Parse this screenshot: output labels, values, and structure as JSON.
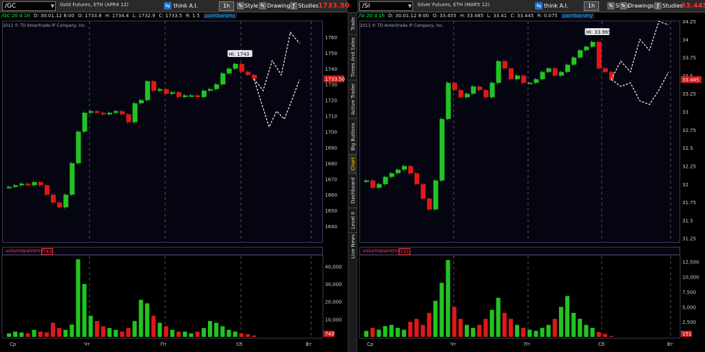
{
  "sidebar": {
    "tabs": [
      "Trade",
      "Times And Sales",
      "Active Trader",
      "Big Buttons",
      "Chart",
      "Dashboard",
      "Level II",
      "Live News"
    ],
    "active": "Chart"
  },
  "toolbar": {
    "think_label": "think A.I.",
    "timeframe": "1h",
    "style_label": "Style",
    "drawings_label": "Drawings",
    "studies_label": "Studies"
  },
  "panels": [
    {
      "symbol": "/GC",
      "description": "Gold Futures, ETH (APR4 12)",
      "last_price": "1733.50",
      "last_price_badge": "1733.50",
      "info": {
        "symbol_tag": "/GC 20 d 1h",
        "date": "D: 30.01.12 8:00",
        "open": "O: 1733.8",
        "high": "H: 1734.4",
        "low": "L: 1732.9",
        "close": "C: 1733.5",
        "range": "R: 1.5",
        "study": "paintbarsmy"
      },
      "copyright": "2011 © TD Ameritrade IP Company, Inc.",
      "hi_label": "Hi: 1743",
      "volume_label": "volumepaintmy",
      "volume_value": "743",
      "volume_badge": "743",
      "x_labels": [
        "Ср",
        "Чт",
        "Пт",
        "Сб",
        "Вт"
      ],
      "volume_axis": [
        "40,000",
        "30,000",
        "20,000",
        "10,000"
      ],
      "colors": {
        "up": "#22c422",
        "down": "#e01818"
      }
    },
    {
      "symbol": "/SI",
      "description": "Silver Futures, ETH (MAR5 12)",
      "last_price": "33.445",
      "last_price_badge": "33.445",
      "info": {
        "symbol_tag": "/SI 20 d 1h",
        "date": "D: 30.01.12 8:00",
        "open": "O: 33.455",
        "high": "H: 33.485",
        "low": "L: 33.41",
        "close": "C: 33.445",
        "range": "R: 0.075",
        "study": "paintbarsmy"
      },
      "copyright": "2011 © TD Ameritrade IP Company, Inc.",
      "hi_label": "Hi: 33.965",
      "volume_label": "volumepaintmy",
      "volume_value": "151",
      "volume_badge": "151",
      "x_labels": [
        "Ср",
        "Чт",
        "Пт",
        "Сб",
        "Вт"
      ],
      "volume_axis": [
        "12,500",
        "10,000",
        "7,500",
        "5,000",
        "2,500"
      ],
      "colors": {
        "up": "#22c422",
        "down": "#e01818"
      }
    }
  ],
  "chart_data": [
    {
      "type": "line",
      "title": "Gold Futures, ETH (APR4 12) — /GC 20 d 1h",
      "ylim": [
        1630,
        1770
      ],
      "yticks": [
        1640,
        1650,
        1660,
        1670,
        1680,
        1690,
        1700,
        1710,
        1720,
        1730,
        1740,
        1750,
        1760
      ],
      "x": [
        "Ср",
        "Чт",
        "Пт",
        "Сб",
        "Вт"
      ],
      "series": [
        {
          "name": "/GC",
          "values": [
            1665,
            1666,
            1667,
            1666,
            1668,
            1666,
            1660,
            1655,
            1652,
            1660,
            1680,
            1700,
            1712,
            1713,
            1712,
            1711,
            1712,
            1713,
            1711,
            1706,
            1718,
            1720,
            1732,
            1726,
            1727,
            1724,
            1725,
            1722,
            1723,
            1723,
            1722,
            1726,
            1727,
            1730,
            1737,
            1740,
            1743,
            1738,
            1736,
            1733.5
          ]
        }
      ],
      "projection_paths": [
        [
          1733.5,
          1726,
          1745,
          1736,
          1763,
          1756
        ],
        [
          1733.5,
          1718,
          1703,
          1713,
          1708,
          1720,
          1733
        ]
      ],
      "volume": [
        2000,
        3000,
        2500,
        2000,
        4000,
        3000,
        2500,
        8000,
        5000,
        4000,
        7000,
        44000,
        30000,
        12000,
        9000,
        6000,
        5000,
        4000,
        3000,
        5000,
        9000,
        21000,
        19000,
        12000,
        8000,
        6000,
        4000,
        3000,
        3000,
        2000,
        3000,
        5000,
        9000,
        8000,
        6000,
        4000,
        3000,
        2000,
        1500,
        743
      ]
    },
    {
      "type": "line",
      "title": "Silver Futures, ETH (MAR5 12) — /SI 20 d 1h",
      "ylim": [
        31.2,
        34.25
      ],
      "yticks": [
        31.25,
        31.5,
        31.75,
        32,
        32.25,
        32.5,
        32.75,
        33,
        33.25,
        33.5,
        33.75,
        34,
        34.25
      ],
      "x": [
        "Ср",
        "Чт",
        "Пт",
        "Сб",
        "Вт"
      ],
      "series": [
        {
          "name": "/SI",
          "values": [
            32.05,
            31.95,
            32.0,
            32.1,
            32.15,
            32.2,
            32.25,
            32.15,
            32.0,
            31.8,
            31.65,
            32.05,
            32.9,
            33.4,
            33.3,
            33.2,
            33.25,
            33.35,
            33.3,
            33.2,
            33.4,
            33.7,
            33.6,
            33.45,
            33.5,
            33.4,
            33.4,
            33.45,
            33.55,
            33.6,
            33.5,
            33.55,
            33.65,
            33.75,
            33.85,
            33.9,
            33.965,
            33.6,
            33.55,
            33.445
          ]
        }
      ],
      "projection_paths": [
        [
          33.445,
          33.7,
          33.55,
          34.0,
          33.85,
          34.25,
          34.2
        ],
        [
          33.445,
          33.35,
          33.4,
          33.15,
          33.1,
          33.3,
          33.55
        ]
      ],
      "volume": [
        1000,
        1500,
        1200,
        1800,
        2000,
        1500,
        1200,
        2500,
        3000,
        2000,
        4000,
        6000,
        9000,
        12800,
        5000,
        3000,
        2000,
        1500,
        2000,
        3000,
        4500,
        6500,
        4000,
        3000,
        2000,
        1500,
        1200,
        1000,
        1500,
        2000,
        3000,
        5000,
        6800,
        4000,
        3000,
        2000,
        1500,
        800,
        500,
        151
      ]
    }
  ]
}
